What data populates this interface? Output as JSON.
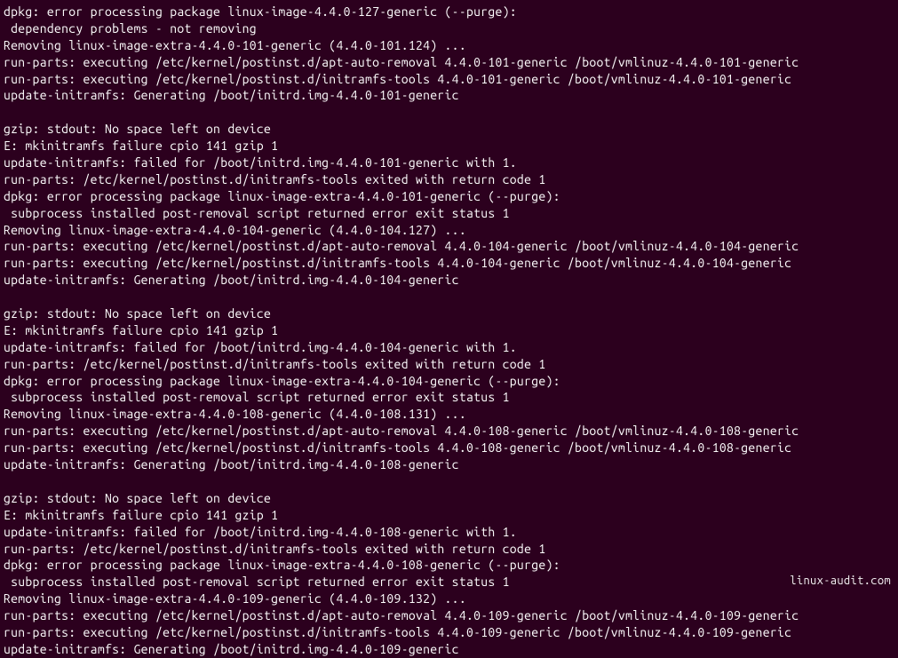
{
  "terminal": {
    "lines": [
      "dpkg: error processing package linux-image-4.4.0-127-generic (--purge):",
      " dependency problems - not removing",
      "Removing linux-image-extra-4.4.0-101-generic (4.4.0-101.124) ...",
      "run-parts: executing /etc/kernel/postinst.d/apt-auto-removal 4.4.0-101-generic /boot/vmlinuz-4.4.0-101-generic",
      "run-parts: executing /etc/kernel/postinst.d/initramfs-tools 4.4.0-101-generic /boot/vmlinuz-4.4.0-101-generic",
      "update-initramfs: Generating /boot/initrd.img-4.4.0-101-generic",
      "",
      "gzip: stdout: No space left on device",
      "E: mkinitramfs failure cpio 141 gzip 1",
      "update-initramfs: failed for /boot/initrd.img-4.4.0-101-generic with 1.",
      "run-parts: /etc/kernel/postinst.d/initramfs-tools exited with return code 1",
      "dpkg: error processing package linux-image-extra-4.4.0-101-generic (--purge):",
      " subprocess installed post-removal script returned error exit status 1",
      "Removing linux-image-extra-4.4.0-104-generic (4.4.0-104.127) ...",
      "run-parts: executing /etc/kernel/postinst.d/apt-auto-removal 4.4.0-104-generic /boot/vmlinuz-4.4.0-104-generic",
      "run-parts: executing /etc/kernel/postinst.d/initramfs-tools 4.4.0-104-generic /boot/vmlinuz-4.4.0-104-generic",
      "update-initramfs: Generating /boot/initrd.img-4.4.0-104-generic",
      "",
      "gzip: stdout: No space left on device",
      "E: mkinitramfs failure cpio 141 gzip 1",
      "update-initramfs: failed for /boot/initrd.img-4.4.0-104-generic with 1.",
      "run-parts: /etc/kernel/postinst.d/initramfs-tools exited with return code 1",
      "dpkg: error processing package linux-image-extra-4.4.0-104-generic (--purge):",
      " subprocess installed post-removal script returned error exit status 1",
      "Removing linux-image-extra-4.4.0-108-generic (4.4.0-108.131) ...",
      "run-parts: executing /etc/kernel/postinst.d/apt-auto-removal 4.4.0-108-generic /boot/vmlinuz-4.4.0-108-generic",
      "run-parts: executing /etc/kernel/postinst.d/initramfs-tools 4.4.0-108-generic /boot/vmlinuz-4.4.0-108-generic",
      "update-initramfs: Generating /boot/initrd.img-4.4.0-108-generic",
      "",
      "gzip: stdout: No space left on device",
      "E: mkinitramfs failure cpio 141 gzip 1",
      "update-initramfs: failed for /boot/initrd.img-4.4.0-108-generic with 1.",
      "run-parts: /etc/kernel/postinst.d/initramfs-tools exited with return code 1",
      "dpkg: error processing package linux-image-extra-4.4.0-108-generic (--purge):",
      " subprocess installed post-removal script returned error exit status 1",
      "Removing linux-image-extra-4.4.0-109-generic (4.4.0-109.132) ...",
      "run-parts: executing /etc/kernel/postinst.d/apt-auto-removal 4.4.0-109-generic /boot/vmlinuz-4.4.0-109-generic",
      "run-parts: executing /etc/kernel/postinst.d/initramfs-tools 4.4.0-109-generic /boot/vmlinuz-4.4.0-109-generic",
      "update-initramfs: Generating /boot/initrd.img-4.4.0-109-generic"
    ]
  },
  "watermark": "linux-audit.com"
}
